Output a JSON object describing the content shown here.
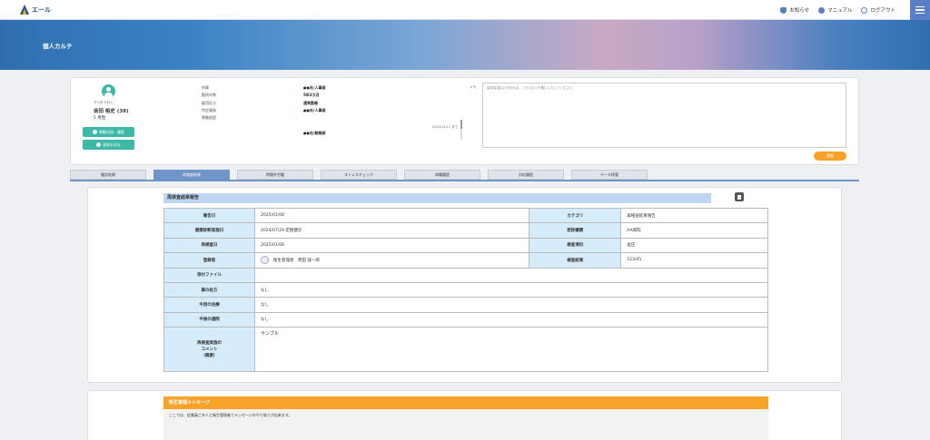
{
  "app": {
    "logo_text": "エール"
  },
  "topnav": {
    "notice": "お知らせ",
    "manual": "マニュアル",
    "logout": "ログアウト"
  },
  "banner": {
    "title": "個人カルテ"
  },
  "profile": {
    "kana": "アイダ ミロシ",
    "name": "会田 裕史 (39)",
    "sex": "男性",
    "btn_history": "異動記録・履歴",
    "btn_contact": "連絡を送る",
    "labels": [
      "所属",
      "勤続年数",
      "雇用区分",
      "特定業務",
      "異動経歴"
    ],
    "values": [
      "●●社/人事部",
      "5年3カ月",
      "通常勤務",
      "",
      ""
    ],
    "history": [
      "●●社/人事部",
      "●●社/総務部"
    ],
    "history_date": "2015/11/11 まで",
    "memo_label": "メモ：",
    "memo_placeholder": "留意事項などがあれば、こちらのメモ欄に入力してください。",
    "save_label": "登録"
  },
  "tabs": [
    "健診結果",
    "再検査結果",
    "時間外労働",
    "ストレスチェック",
    "休職履歴",
    "対応履歴",
    "データ保管"
  ],
  "report": {
    "title": "再検査結果報告",
    "rows": {
      "report_date_l": "報告日",
      "report_date": "2025/01/08",
      "category_l": "カテゴリ",
      "category": "再検査結果報告",
      "checkup_date_l": "健康診断実施日",
      "checkup_date": "2024/07/29 定期健診",
      "hospital_l": "受診機関",
      "hospital": "AA病院",
      "recheck_date_l": "再検査日",
      "recheck_date": "2025/01/08",
      "item_l": "検査項目",
      "item": "血圧",
      "registrant_l": "登録者",
      "registrant": "衛生管理者　荷田 誠一郎",
      "result_l": "検査結果",
      "result": "123/45",
      "attach_l": "添付ファイル",
      "attach": "",
      "medicine_l": "薬の処方",
      "medicine": "なし",
      "treatment_l": "今回の治療",
      "treatment": "なし",
      "visit_l": "今後の通院",
      "visit": "なし",
      "comment_l": "再検査実施の\nコメント\n（概要）",
      "comment": "サンプル"
    }
  },
  "message": {
    "title": "衛生管理メッセージ",
    "body": "ここでは、従業員ご本人と衛生管理者でメッセージのやり取りが出来ます。"
  }
}
